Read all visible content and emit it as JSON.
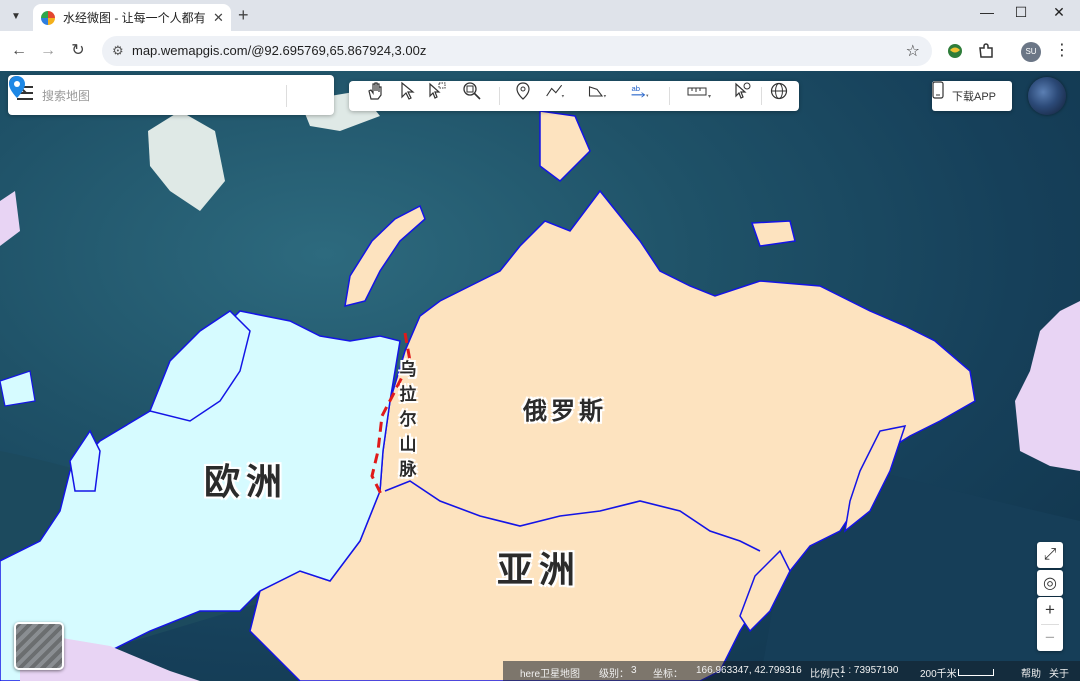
{
  "browser": {
    "tab_title": "水经微图 - 让每一个人都有自己",
    "url": "map.wemapgis.com/@92.695769,65.867924,3.00z",
    "profile_initials": "SU"
  },
  "search": {
    "placeholder": "搜索地图"
  },
  "tools": {
    "items": [
      "pan-tool",
      "select-tool",
      "box-select-tool",
      "zoom-box-tool",
      "marker-tool",
      "polyline-tool",
      "polygon-tool",
      "text-tool",
      "measure-tool",
      "identify-tool",
      "globe-tool"
    ]
  },
  "download": {
    "label": "下载APP"
  },
  "map": {
    "labels": {
      "europe": "欧洲",
      "asia": "亚洲",
      "russia": "俄罗斯",
      "ural": "乌拉尔山脉"
    },
    "colors": {
      "ocean": "#1f5268",
      "europe": "#d6fbff",
      "asia": "#fde3bf",
      "other_land": "#e8d4f4",
      "border": "#1414e6",
      "ural_line": "#e01a1a"
    }
  },
  "status": {
    "layer": "here卫星地图",
    "level_label": "级别：",
    "level_value": "3",
    "coord_label": "坐标：",
    "coords": "166.963347, 42.799316",
    "scale_label": "比例尺：",
    "scale_value": "1 : 73957190",
    "scale_bar": "200千米",
    "help": "帮助",
    "close": "关于"
  }
}
